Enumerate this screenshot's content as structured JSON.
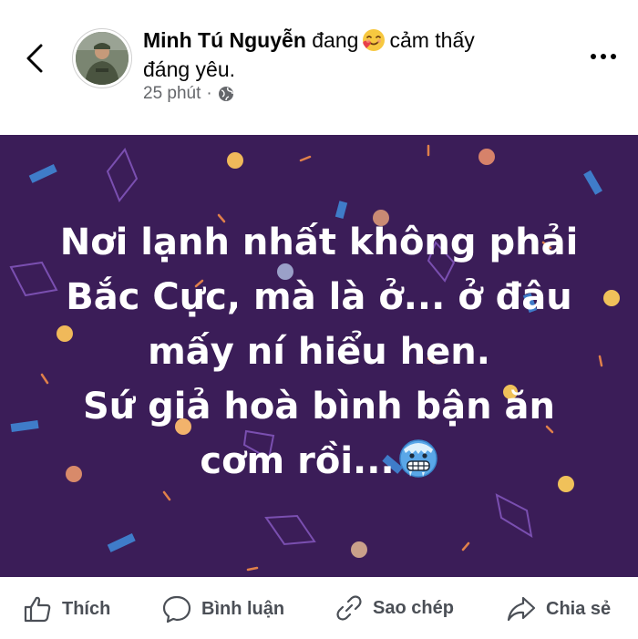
{
  "post": {
    "author": "Minh Tú Nguyễn",
    "status_prefix": "đang",
    "feeling_emoji": "smiling-hearts-emoji",
    "status_rest": "cảm thấy",
    "status_line2": "đáng yêu.",
    "time": "25 phút",
    "privacy_icon": "globe-icon",
    "text_lines": [
      "Nơi lạnh nhất không phải",
      "Bắc Cực, mà là ở... ở đâu",
      "mấy ní hiểu hen.",
      "Sứ giả hoà bình bận ăn",
      "cơm rồi..."
    ],
    "text_emoji": "cold-face-emoji",
    "background_color": "#3b1d58"
  },
  "actions": {
    "like": "Thích",
    "comment": "Bình luận",
    "copy": "Sao chép",
    "share": "Chia sẻ"
  }
}
